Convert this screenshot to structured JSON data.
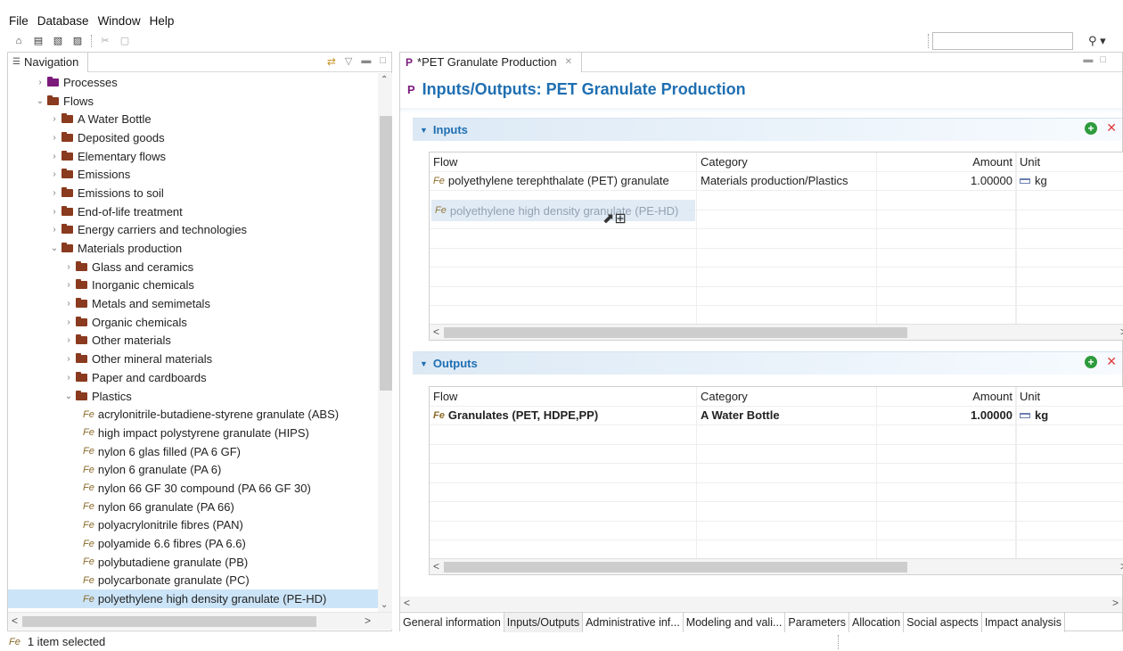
{
  "menu": [
    "File",
    "Database",
    "Window",
    "Help"
  ],
  "toolbar": {
    "buttons": [
      "home-icon",
      "save-icon",
      "save-all-icon",
      "save-as-icon",
      "cut-icon",
      "paste-icon"
    ],
    "search_value": ""
  },
  "navigation": {
    "tab_label": "Navigation",
    "tree": [
      {
        "label": "Processes",
        "indent": 1,
        "expanded": false,
        "kind": "folder",
        "color": "#7b1a7b"
      },
      {
        "label": "Flows",
        "indent": 1,
        "expanded": true,
        "kind": "folder",
        "color": "#8a3a1e"
      },
      {
        "label": "A Water Bottle",
        "indent": 2,
        "expanded": false,
        "kind": "folder",
        "color": "#8a3a1e"
      },
      {
        "label": "Deposited goods",
        "indent": 2,
        "expanded": false,
        "kind": "folder",
        "color": "#8a3a1e"
      },
      {
        "label": "Elementary flows",
        "indent": 2,
        "expanded": false,
        "kind": "folder",
        "color": "#8a3a1e"
      },
      {
        "label": "Emissions",
        "indent": 2,
        "expanded": false,
        "kind": "folder",
        "color": "#8a3a1e"
      },
      {
        "label": "Emissions to soil",
        "indent": 2,
        "expanded": false,
        "kind": "folder",
        "color": "#8a3a1e"
      },
      {
        "label": "End-of-life treatment",
        "indent": 2,
        "expanded": false,
        "kind": "folder",
        "color": "#8a3a1e"
      },
      {
        "label": "Energy carriers and technologies",
        "indent": 2,
        "expanded": false,
        "kind": "folder",
        "color": "#8a3a1e"
      },
      {
        "label": "Materials production",
        "indent": 2,
        "expanded": true,
        "kind": "folder",
        "color": "#8a3a1e"
      },
      {
        "label": "Glass and ceramics",
        "indent": 3,
        "expanded": false,
        "kind": "folder",
        "color": "#8a3a1e"
      },
      {
        "label": "Inorganic chemicals",
        "indent": 3,
        "expanded": false,
        "kind": "folder",
        "color": "#8a3a1e"
      },
      {
        "label": "Metals and semimetals",
        "indent": 3,
        "expanded": false,
        "kind": "folder",
        "color": "#8a3a1e"
      },
      {
        "label": "Organic chemicals",
        "indent": 3,
        "expanded": false,
        "kind": "folder",
        "color": "#8a3a1e"
      },
      {
        "label": "Other materials",
        "indent": 3,
        "expanded": false,
        "kind": "folder",
        "color": "#8a3a1e"
      },
      {
        "label": "Other mineral materials",
        "indent": 3,
        "expanded": false,
        "kind": "folder",
        "color": "#8a3a1e"
      },
      {
        "label": "Paper and cardboards",
        "indent": 3,
        "expanded": false,
        "kind": "folder",
        "color": "#8a3a1e"
      },
      {
        "label": "Plastics",
        "indent": 3,
        "expanded": true,
        "kind": "folder",
        "color": "#8a3a1e"
      },
      {
        "label": "acrylonitrile-butadiene-styrene granulate (ABS)",
        "indent": 4,
        "kind": "flow"
      },
      {
        "label": "high impact polystyrene granulate (HIPS)",
        "indent": 4,
        "kind": "flow"
      },
      {
        "label": "nylon 6 glas filled (PA 6 GF)",
        "indent": 4,
        "kind": "flow"
      },
      {
        "label": "nylon 6 granulate (PA 6)",
        "indent": 4,
        "kind": "flow"
      },
      {
        "label": "nylon 66 GF 30 compound (PA 66 GF 30)",
        "indent": 4,
        "kind": "flow"
      },
      {
        "label": "nylon 66 granulate (PA 66)",
        "indent": 4,
        "kind": "flow"
      },
      {
        "label": "polyacrylonitrile fibres (PAN)",
        "indent": 4,
        "kind": "flow"
      },
      {
        "label": "polyamide 6.6 fibres (PA 6.6)",
        "indent": 4,
        "kind": "flow"
      },
      {
        "label": "polybutadiene granulate (PB)",
        "indent": 4,
        "kind": "flow"
      },
      {
        "label": "polycarbonate granulate (PC)",
        "indent": 4,
        "kind": "flow"
      },
      {
        "label": "polyethylene high density granulate (PE-HD)",
        "indent": 4,
        "kind": "flow",
        "selected": true
      }
    ]
  },
  "editor": {
    "tab_label": "*PET Granulate Production",
    "title": "Inputs/Outputs: PET Granulate Production",
    "inputs": {
      "heading": "Inputs",
      "columns": {
        "flow": "Flow",
        "category": "Category",
        "amount": "Amount",
        "unit": "Unit"
      },
      "rows": [
        {
          "flow": "polyethylene terephthalate (PET) granulate",
          "category": "Materials production/Plastics",
          "amount": "1.00000",
          "unit": "kg"
        }
      ],
      "drag_ghost": "polyethylene high density granulate (PE-HD)"
    },
    "outputs": {
      "heading": "Outputs",
      "columns": {
        "flow": "Flow",
        "category": "Category",
        "amount": "Amount",
        "unit": "Unit"
      },
      "rows": [
        {
          "flow": "Granulates (PET, HDPE,PP)",
          "category": "A Water Bottle",
          "amount": "1.00000",
          "unit": "kg",
          "bold": true
        }
      ]
    },
    "bottom_tabs": [
      "General information",
      "Inputs/Outputs",
      "Administrative inf...",
      "Modeling and vali...",
      "Parameters",
      "Allocation",
      "Social aspects",
      "Impact analysis"
    ],
    "active_bottom_tab": "Inputs/Outputs"
  },
  "status": {
    "text": "1 item selected"
  },
  "colors": {
    "accent": "#1f6fb2",
    "selection": "#cce4f7",
    "add": "#2d9b3c",
    "remove": "#e03a3a"
  }
}
